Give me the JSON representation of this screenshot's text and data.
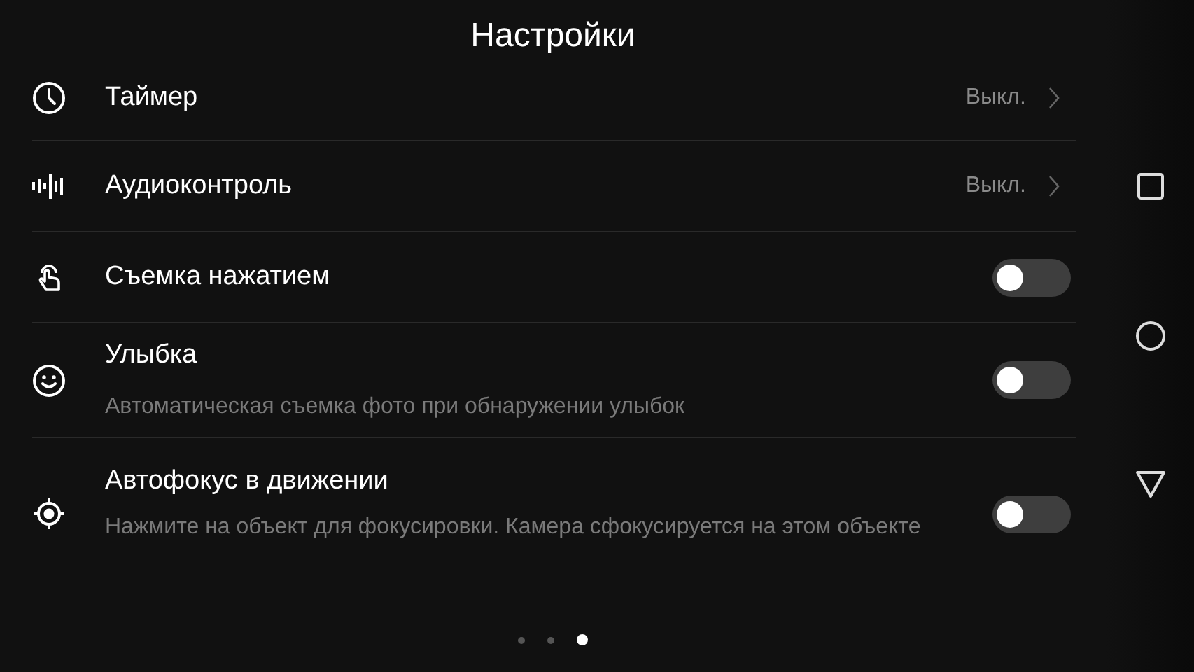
{
  "title": "Настройки",
  "settings": [
    {
      "kind": "value",
      "label": "Таймер",
      "value": "Выкл."
    },
    {
      "kind": "value",
      "label": "Аудиоконтроль",
      "value": "Выкл."
    },
    {
      "kind": "toggle",
      "label": "Съемка нажатием",
      "on": false
    },
    {
      "kind": "toggle",
      "label": "Улыбка",
      "description": "Автоматическая съемка фото при обнаружении улыбок",
      "on": false
    },
    {
      "kind": "toggle",
      "label": "Автофокус в движении",
      "description": "Нажмите на объект для фокусировки. Камера сфокусируется на этом объекте",
      "on": false
    }
  ],
  "page_dots": [
    {
      "selected": false
    },
    {
      "selected": false
    },
    {
      "selected": true
    }
  ]
}
